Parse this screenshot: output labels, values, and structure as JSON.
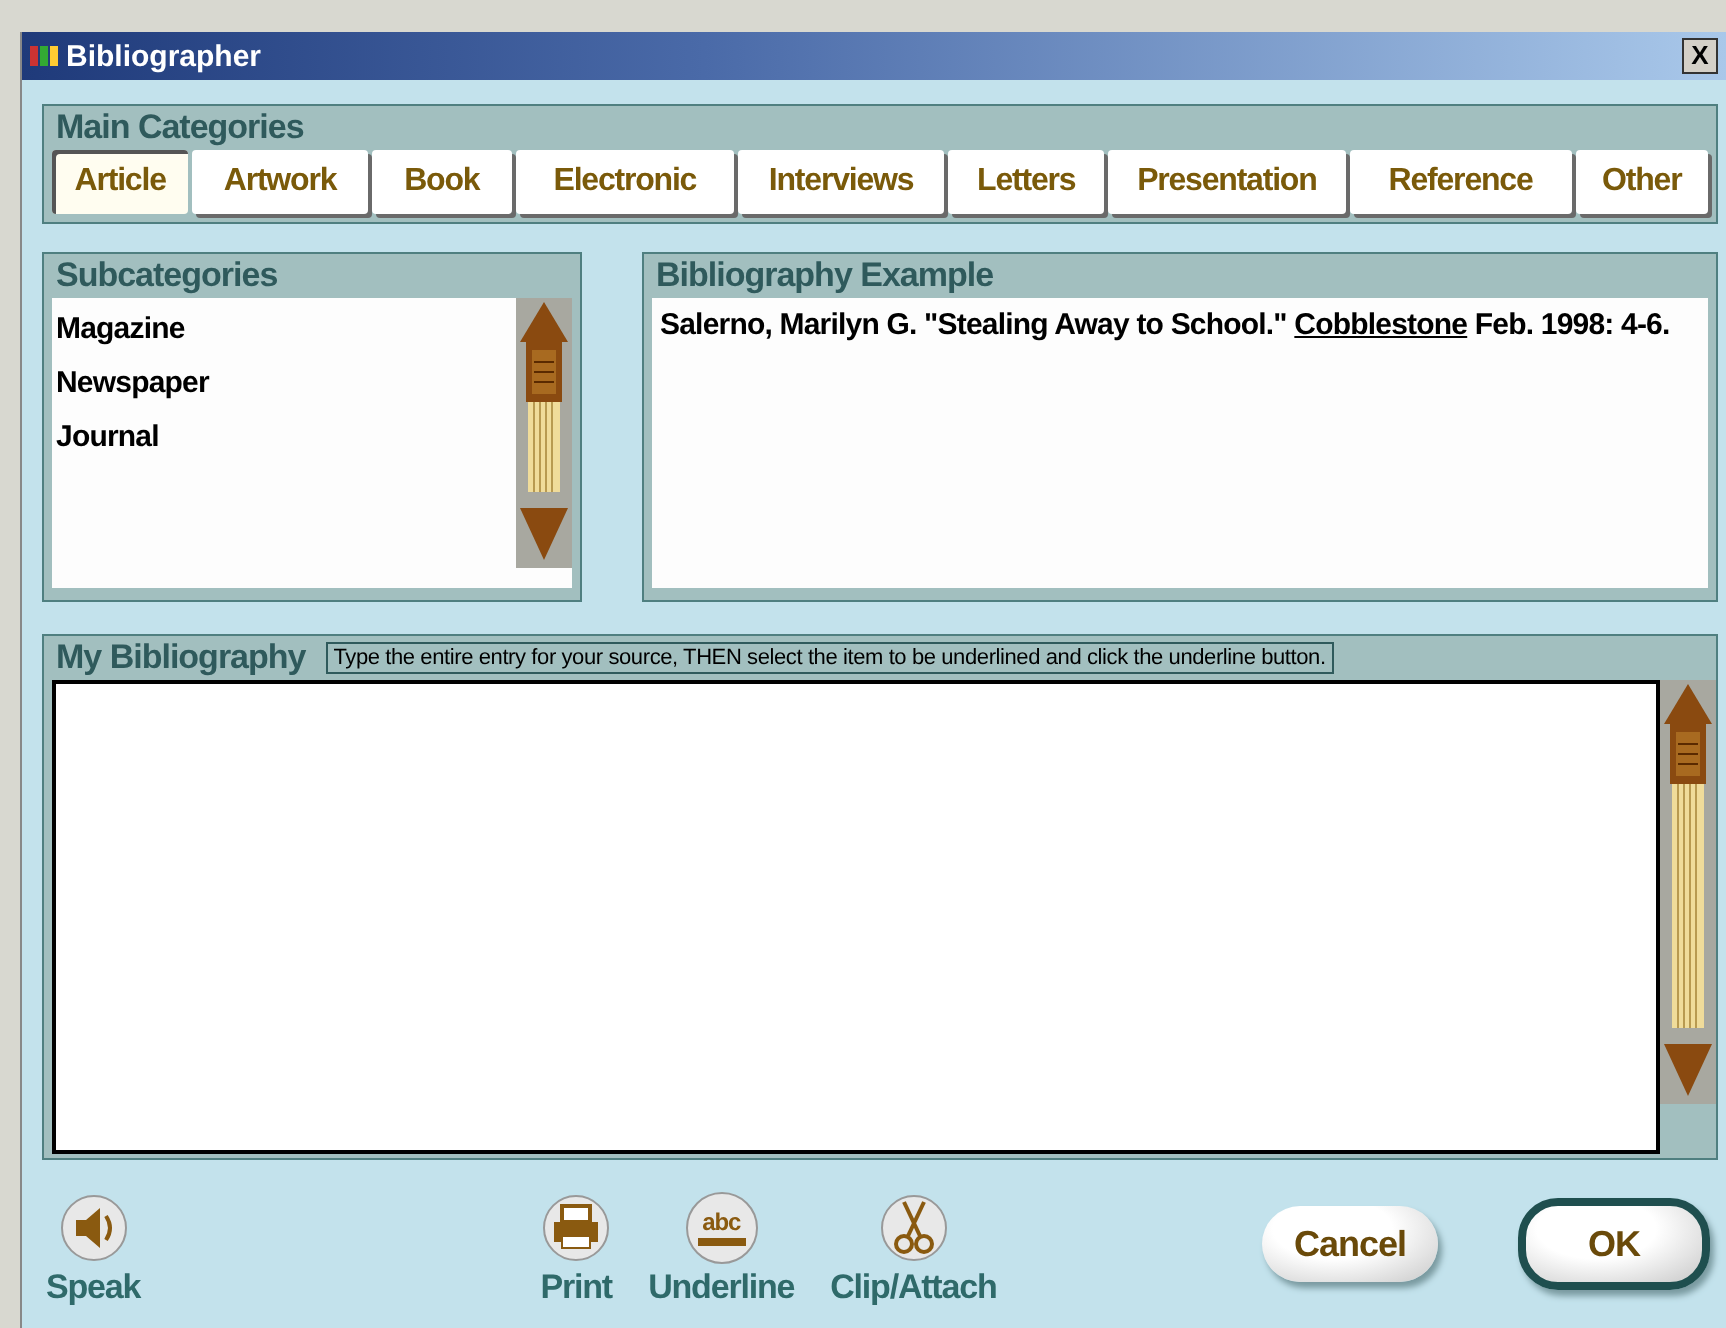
{
  "window": {
    "title": "Bibliographer",
    "close": "X"
  },
  "main_categories": {
    "title": "Main Categories",
    "tabs": [
      {
        "label": "Article",
        "selected": true
      },
      {
        "label": "Artwork",
        "selected": false
      },
      {
        "label": "Book",
        "selected": false
      },
      {
        "label": "Electronic",
        "selected": false
      },
      {
        "label": "Interviews",
        "selected": false
      },
      {
        "label": "Letters",
        "selected": false
      },
      {
        "label": "Presentation",
        "selected": false
      },
      {
        "label": "Reference",
        "selected": false
      },
      {
        "label": "Other",
        "selected": false
      }
    ]
  },
  "subcategories": {
    "title": "Subcategories",
    "items": [
      {
        "label": "Magazine",
        "selected": false
      },
      {
        "label": "Newspaper",
        "selected": false
      },
      {
        "label": "Journal",
        "selected": false
      }
    ]
  },
  "example": {
    "title": "Bibliography Example",
    "segments": [
      {
        "text": "Salerno, Marilyn G. \"Stealing Away to School.\" ",
        "underlined": false
      },
      {
        "text": "Cobblestone",
        "underlined": true
      },
      {
        "text": " Feb. 1998: 4-6.",
        "underlined": false
      }
    ]
  },
  "my_bibliography": {
    "title": "My Bibliography",
    "hint": "Type the entire entry for your source, THEN select the item to be underlined and click the underline button."
  },
  "toolbar": [
    {
      "kind": "speak",
      "label": "Speak"
    },
    {
      "kind": "print",
      "label": "Print"
    },
    {
      "kind": "underline",
      "label": "Underline",
      "icon_text": "abc"
    },
    {
      "kind": "clip",
      "label": "Clip/Attach"
    }
  ],
  "buttons": [
    {
      "label": "Cancel",
      "default": false
    },
    {
      "label": "OK",
      "default": true
    }
  ]
}
